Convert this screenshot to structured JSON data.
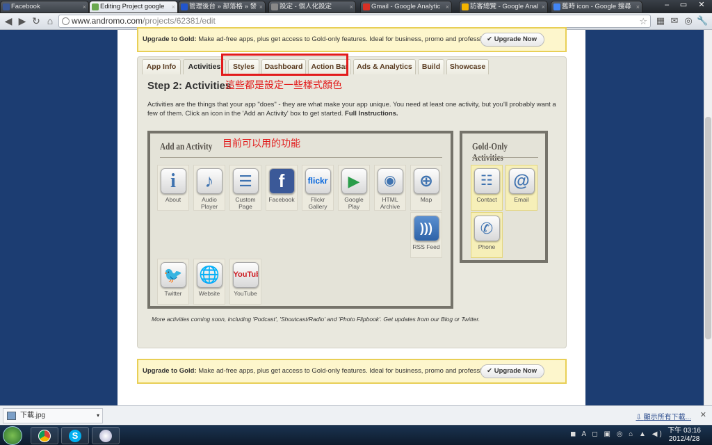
{
  "browser_tabs": [
    {
      "label": "Facebook",
      "fav": "#3b5998"
    },
    {
      "label": "Editing Project google",
      "fav": "#6aa84f"
    },
    {
      "label": "管理後台 » 部落格 » 發",
      "fav": "#2255cc"
    },
    {
      "label": "設定 - 個人化設定",
      "fav": "#888888"
    },
    {
      "label": "Gmail - Google Analytic",
      "fav": "#d93025"
    },
    {
      "label": "訪客總覽 - Google Anal",
      "fav": "#f4b400"
    },
    {
      "label": "舊時 icon - Google 搜尋",
      "fav": "#4285f4"
    }
  ],
  "url": {
    "host": "www.andromo.com",
    "path": "/projects/62381/edit"
  },
  "upgrade": {
    "strong": "Upgrade to Gold:",
    "text": " Make ad-free apps, plus get access to Gold-only features. Ideal for business, promo and professional apps.",
    "button": "Upgrade Now"
  },
  "tabs": [
    "App Info",
    "Activities",
    "Styles",
    "Dashboard",
    "Action Bar",
    "Ads & Analytics",
    "Build",
    "Showcase"
  ],
  "annotation1": "這些都是設定一些樣式顏色",
  "annotation2": "目前可以用的功能",
  "step_title": "Step 2: Activities",
  "description": "Activities are the things that your app \"does\" - they are what make your app unique. You need at least one activity, but you'll probably want a few of them. Click an icon in the 'Add an Activity' box to get started.",
  "full_instructions": "Full Instructions.",
  "add_title": "Add an Activity",
  "gold_title": "Gold-Only Activities",
  "activities": [
    "About",
    "Audio Player",
    "Custom Page",
    "Facebook",
    "Flickr Gallery",
    "Google Play",
    "HTML Archive",
    "Map",
    "RSS Feed",
    "Twitter",
    "Website",
    "YouTube"
  ],
  "gold_activities": [
    "Contact",
    "Email",
    "Phone"
  ],
  "more_note": "More activities coming soon, including 'Podcast', 'Shoutcast/Radio' and 'Photo Flipbook'. Get updates from our Blog or Twitter.",
  "download": {
    "file": "下載.jpg",
    "show_all": "顯示所有下載..."
  },
  "clock": {
    "time": "下午 03:16",
    "date": "2012/4/28"
  }
}
